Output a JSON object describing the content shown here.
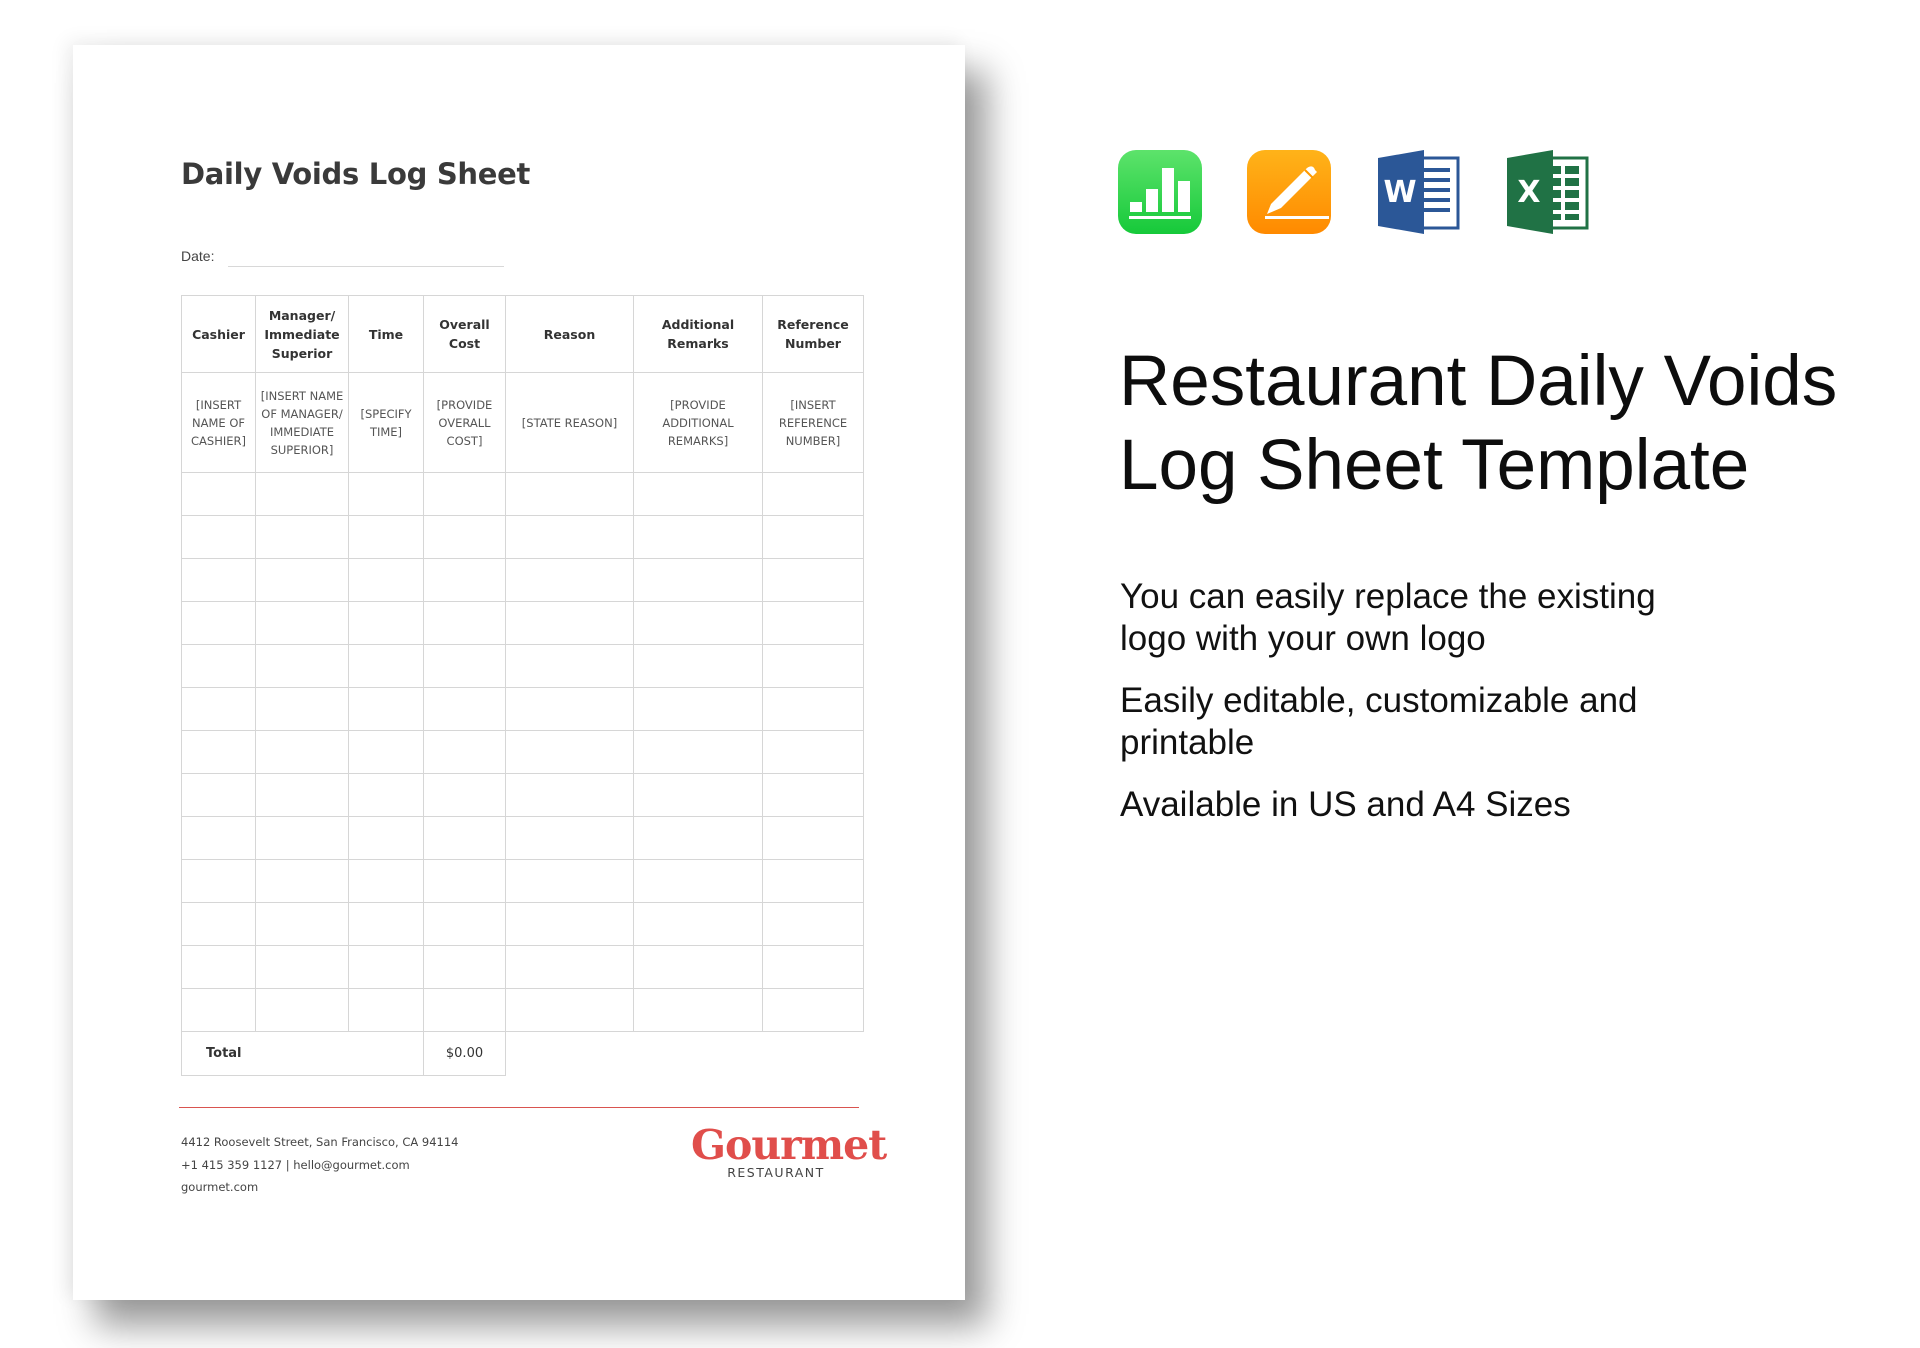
{
  "document": {
    "title": "Daily Voids Log Sheet",
    "date_label": "Date:",
    "date_value": "",
    "table": {
      "headers": [
        "Cashier",
        "Manager/ Immediate Superior",
        "Time",
        "Overall Cost",
        "Reason",
        "Additional Remarks",
        "Reference Number"
      ],
      "sample_row": [
        "[INSERT NAME OF CASHIER]",
        "[INSERT NAME OF MANAGER/ IMMEDIATE SUPERIOR]",
        "[SPECIFY TIME]",
        "[PROVIDE OVERALL COST]",
        "[STATE REASON]",
        "[PROVIDE ADDITIONAL REMARKS]",
        "[INSERT REFERENCE NUMBER]"
      ],
      "empty_row_count": 13,
      "total_label": "Total",
      "total_value": "$0.00"
    },
    "footer": {
      "address": "4412 Roosevelt Street, San Francisco, CA 94114",
      "contact": "+1 415 359 1127 | hello@gourmet.com",
      "website": "gourmet.com",
      "logo_word": "Gourmet",
      "logo_sub": "RESTAURANT",
      "accent_color": "#e04e4b"
    }
  },
  "promo": {
    "app_icons": [
      {
        "name": "numbers-icon",
        "color": "#2fd94a"
      },
      {
        "name": "pages-icon",
        "color": "#ff9500"
      },
      {
        "name": "word-icon",
        "letter": "W",
        "color": "#2b5797"
      },
      {
        "name": "excel-icon",
        "letter": "X",
        "color": "#207245"
      }
    ],
    "title": "Restaurant Daily Voids Log Sheet Template",
    "features": [
      "You can easily replace the existing logo with your own logo",
      "Easily editable, customizable and printable",
      "Available in US and A4 Sizes"
    ]
  }
}
